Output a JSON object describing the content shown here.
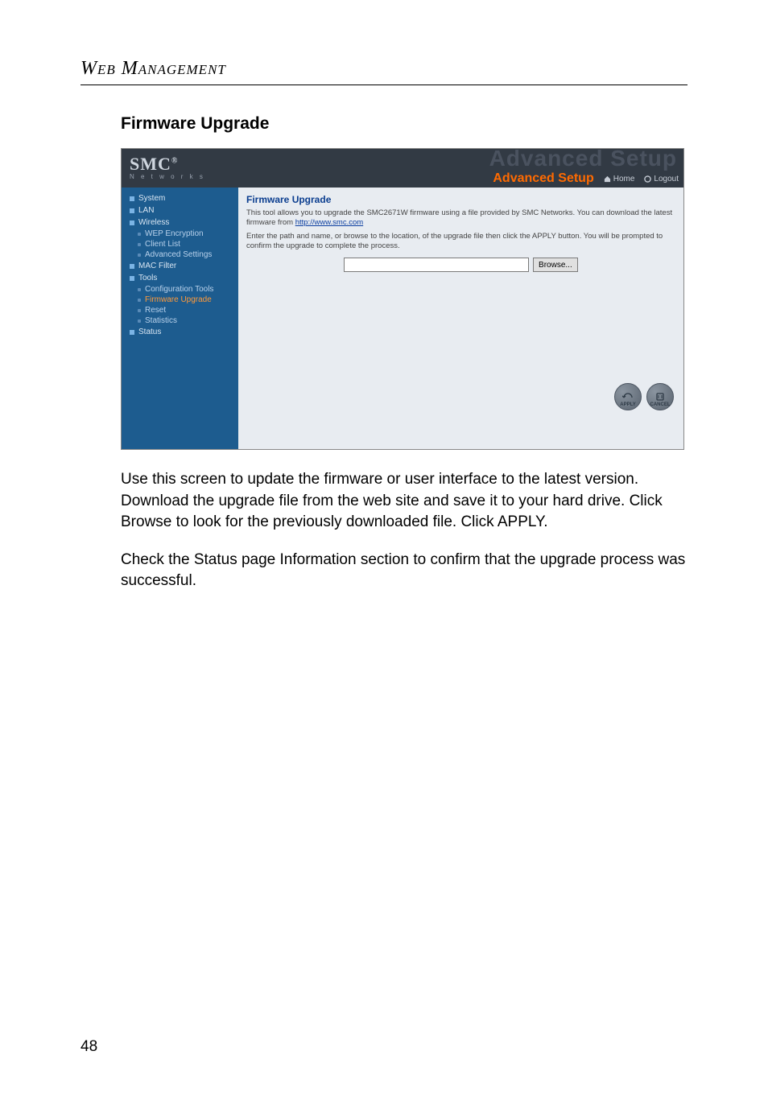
{
  "header": {
    "title": "Web Management"
  },
  "section": {
    "title": "Firmware Upgrade"
  },
  "screenshot": {
    "logo": {
      "brand": "SMC",
      "reg": "®",
      "sub": "N e t w o r k s"
    },
    "watermark": "Advanced Setup",
    "topbar": {
      "advanced": "Advanced Setup",
      "home": "Home",
      "logout": "Logout"
    },
    "sidebar": {
      "top": [
        "System",
        "LAN",
        "Wireless"
      ],
      "wireless_sub": [
        "WEP Encryption",
        "Client List",
        "Advanced Settings"
      ],
      "mid": [
        "MAC Filter",
        "Tools"
      ],
      "tools_sub": [
        "Configuration Tools",
        "Firmware Upgrade",
        "Reset",
        "Statistics"
      ],
      "bottom": [
        "Status"
      ],
      "active_sub": "Firmware Upgrade"
    },
    "content": {
      "title": "Firmware Upgrade",
      "p1a": "This tool allows you to upgrade the SMC2671W firmware using a file provided by SMC Networks. You can download the latest firmware from ",
      "link": "http://www.smc.com",
      "p2": "Enter the path and name, or browse to the location, of the upgrade file then click the APPLY button. You will be prompted to confirm the upgrade to complete the process.",
      "browse": "Browse...",
      "apply": "APPLY",
      "cancel": "CANCEL"
    }
  },
  "paras": {
    "p1": "Use this screen to update the firmware or user interface to the latest version. Download the upgrade file from the web site and save it to your hard drive. Click Browse to look for the previously downloaded file. Click APPLY.",
    "p2": "Check the Status page Information section to confirm that the upgrade process was successful."
  },
  "page_number": "48"
}
